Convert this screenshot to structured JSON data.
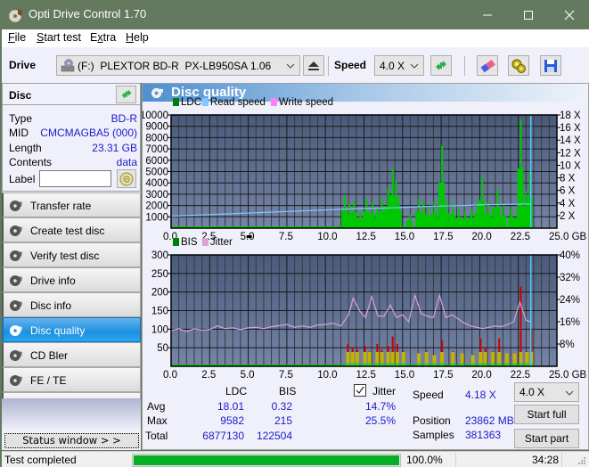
{
  "window": {
    "title": "Opti Drive Control 1.70",
    "controls": {
      "minimize": "minimize-icon",
      "maximize": "maximize-icon",
      "close": "close-icon"
    }
  },
  "menu": [
    {
      "label": "File",
      "accel": "F",
      "rest": "ile"
    },
    {
      "label": "Start test",
      "accel": "S",
      "rest": "tart test"
    },
    {
      "label": "Extra",
      "accel": "x",
      "pre": "E",
      "rest": "tra"
    },
    {
      "label": "Help",
      "accel": "H",
      "rest": "elp"
    }
  ],
  "toolbar": {
    "drive_label": "Drive",
    "drive_value": "(F:)  PLEXTOR BD-R  PX-LB950SA 1.06",
    "speed_label": "Speed",
    "speed_value": "4.0 X",
    "icons": [
      "eject-icon",
      "refresh-icon",
      "eraser-icon",
      "settings-icon",
      "save-icon"
    ]
  },
  "disc": {
    "header": "Disc",
    "rows": [
      {
        "key": "Type",
        "value": "BD-R"
      },
      {
        "key": "MID",
        "value": "CMCMAGBA5 (000)"
      },
      {
        "key": "Length",
        "value": "23.31 GB"
      },
      {
        "key": "Contents",
        "value": "data"
      }
    ],
    "label_key": "Label",
    "label_value": ""
  },
  "nav": [
    {
      "label": "Transfer rate",
      "active": false
    },
    {
      "label": "Create test disc",
      "active": false
    },
    {
      "label": "Verify test disc",
      "active": false
    },
    {
      "label": "Drive info",
      "active": false
    },
    {
      "label": "Disc info",
      "active": false
    },
    {
      "label": "Disc quality",
      "active": true
    },
    {
      "label": "CD Bler",
      "active": false
    },
    {
      "label": "FE / TE",
      "active": false
    },
    {
      "label": "Extra tests",
      "active": false
    }
  ],
  "status_window_button": "Status window > >",
  "panel_title": "Disc quality",
  "colors": {
    "ldc": "#00c800",
    "ldc_legend": "#008000",
    "read_speed": "#80c8ff",
    "write_speed": "#ff80ff",
    "bis": "#00c800",
    "bis_legend": "#008000",
    "jitter": "#d8a0d8",
    "plot_bg_top": "#4a5a7a",
    "plot_bg_bottom": "#7585a8",
    "accent": "#1a1ad0"
  },
  "chart_data": [
    {
      "type": "bar",
      "title": "LDC / Read speed",
      "legend": [
        "LDC",
        "Read speed",
        "Write speed"
      ],
      "xlabel": "GB",
      "xlim": [
        0,
        25
      ],
      "x_ticks": [
        "0.0",
        "2.5",
        "5.0",
        "7.5",
        "10.0",
        "12.5",
        "15.0",
        "17.5",
        "20.0",
        "22.5",
        "25.0 GB"
      ],
      "ylim_left": [
        0,
        10000
      ],
      "y_ticks_left": [
        "10000",
        "9000",
        "8000",
        "7000",
        "6000",
        "5000",
        "4000",
        "3000",
        "2000",
        "1000"
      ],
      "ylim_right": [
        0,
        18
      ],
      "y_ticks_right": [
        "18 X",
        "16 X",
        "14 X",
        "12 X",
        "10 X",
        "8 X",
        "6 X",
        "4 X",
        "2 X"
      ],
      "grid": true,
      "series": [
        {
          "name": "LDC",
          "kind": "bars",
          "x": [
            0.5,
            2.0,
            5.5,
            8.0,
            9.5,
            11.2,
            11.5,
            11.8,
            12.2,
            12.6,
            13.0,
            13.3,
            13.6,
            14.0,
            14.3,
            14.5,
            14.7,
            15.4,
            16.0,
            16.3,
            16.6,
            17.0,
            17.3,
            17.5,
            17.8,
            18.2,
            18.6,
            19.0,
            19.4,
            19.8,
            20.1,
            20.5,
            20.8,
            21.1,
            21.5,
            22.0,
            22.4,
            22.6,
            22.9,
            23.2
          ],
          "values": [
            50,
            60,
            80,
            60,
            100,
            2900,
            2200,
            2500,
            1500,
            2700,
            2300,
            1800,
            2700,
            3500,
            5300,
            4200,
            2800,
            1200,
            2600,
            2300,
            1900,
            2400,
            1800,
            7300,
            2400,
            2200,
            1600,
            1500,
            1700,
            2400,
            4500,
            2300,
            1800,
            3400,
            2000,
            1800,
            1700,
            9600,
            3300,
            5000
          ]
        },
        {
          "name": "Read speed",
          "kind": "line",
          "x": [
            0,
            1,
            2,
            3,
            4,
            5,
            6,
            7,
            8,
            9,
            10,
            11,
            12,
            13,
            14,
            15,
            16,
            17,
            18,
            19,
            20,
            21,
            22,
            23.31
          ],
          "values": [
            1.9,
            2.0,
            2.1,
            2.2,
            2.3,
            2.4,
            2.5,
            2.6,
            2.7,
            2.8,
            2.9,
            3.0,
            3.1,
            3.15,
            3.2,
            3.3,
            3.4,
            3.5,
            3.55,
            3.6,
            3.7,
            3.75,
            3.8,
            3.85
          ]
        }
      ],
      "end_marker_gb": 23.31
    },
    {
      "type": "bar",
      "title": "BIS / Jitter",
      "legend": [
        "BIS",
        "Jitter"
      ],
      "xlabel": "GB",
      "xlim": [
        0,
        25
      ],
      "x_ticks": [
        "0.0",
        "2.5",
        "5.0",
        "7.5",
        "10.0",
        "12.5",
        "15.0",
        "17.5",
        "20.0",
        "22.5",
        "25.0 GB"
      ],
      "ylim_left": [
        0,
        300
      ],
      "y_ticks_left": [
        "300",
        "250",
        "200",
        "150",
        "100",
        "50"
      ],
      "ylim_right": [
        0,
        40
      ],
      "y_ticks_right": [
        "40%",
        "32%",
        "24%",
        "16%",
        "8%"
      ],
      "grid": true,
      "series": [
        {
          "name": "BIS",
          "kind": "bars",
          "x": [
            11.4,
            11.7,
            12.0,
            12.5,
            12.8,
            13.3,
            13.6,
            14.0,
            14.3,
            14.6,
            15.0,
            16.0,
            16.5,
            17.0,
            17.5,
            18.2,
            18.8,
            19.5,
            20.0,
            20.3,
            20.8,
            21.2,
            21.7,
            22.2,
            22.6,
            23.0,
            23.3
          ],
          "values": [
            60,
            50,
            45,
            55,
            40,
            60,
            45,
            55,
            80,
            60,
            40,
            35,
            40,
            30,
            70,
            40,
            35,
            30,
            75,
            50,
            40,
            75,
            35,
            35,
            215,
            40,
            100
          ]
        },
        {
          "name": "Jitter",
          "kind": "line",
          "x": [
            0,
            0.5,
            1,
            1.5,
            2,
            2.5,
            3,
            3.5,
            4,
            4.5,
            5,
            5.5,
            6,
            6.5,
            7,
            7.5,
            8,
            8.5,
            9,
            9.5,
            10,
            10.5,
            11,
            11.5,
            11.8,
            12.2,
            12.6,
            13,
            13.4,
            13.8,
            14.2,
            14.6,
            15,
            15.4,
            15.8,
            16.2,
            16.6,
            17,
            17.4,
            17.8,
            18.2,
            18.6,
            19,
            19.4,
            19.8,
            20.2,
            20.6,
            21,
            21.4,
            21.8,
            22.2,
            22.6,
            23,
            23.3
          ],
          "values": [
            12.8,
            13.5,
            12.5,
            13.5,
            13.0,
            13.2,
            14.5,
            13.5,
            13.8,
            13.2,
            13.8,
            14.0,
            13.5,
            14.2,
            14.6,
            15.0,
            14.0,
            14.5,
            14.0,
            14.8,
            15.0,
            15.5,
            14.5,
            18.5,
            24.5,
            20.0,
            17.5,
            25.0,
            18.0,
            18.0,
            22.0,
            17.5,
            18.5,
            16.0,
            25.5,
            19.0,
            18.0,
            17.5,
            25.5,
            17.5,
            18.5,
            17.0,
            15.5,
            14.5,
            14.0,
            13.5,
            14.0,
            14.5,
            14.2,
            15.0,
            16.0,
            23.0,
            16.5,
            16.0
          ]
        }
      ],
      "end_marker_gb": 23.31
    }
  ],
  "stats": {
    "col_ldc": "LDC",
    "col_bis": "BIS",
    "jitter_checked": true,
    "jitter_label": "Jitter",
    "rows": [
      {
        "label": "Avg",
        "ldc": "18.01",
        "bis": "0.32",
        "jitter": "14.7%"
      },
      {
        "label": "Max",
        "ldc": "9582",
        "bis": "215",
        "jitter": "25.5%"
      },
      {
        "label": "Total",
        "ldc": "6877130",
        "bis": "122504",
        "jitter": ""
      }
    ],
    "speed_label": "Speed",
    "speed_value": "4.18 X",
    "position_label": "Position",
    "position_value": "23862 MB",
    "samples_label": "Samples",
    "samples_value": "381363",
    "speed_select": "4.0 X",
    "start_full": "Start full",
    "start_part": "Start part"
  },
  "statusbar": {
    "text": "Test completed",
    "progress_percent": 100.0,
    "progress_label": "100.0%",
    "elapsed": "34:28"
  }
}
